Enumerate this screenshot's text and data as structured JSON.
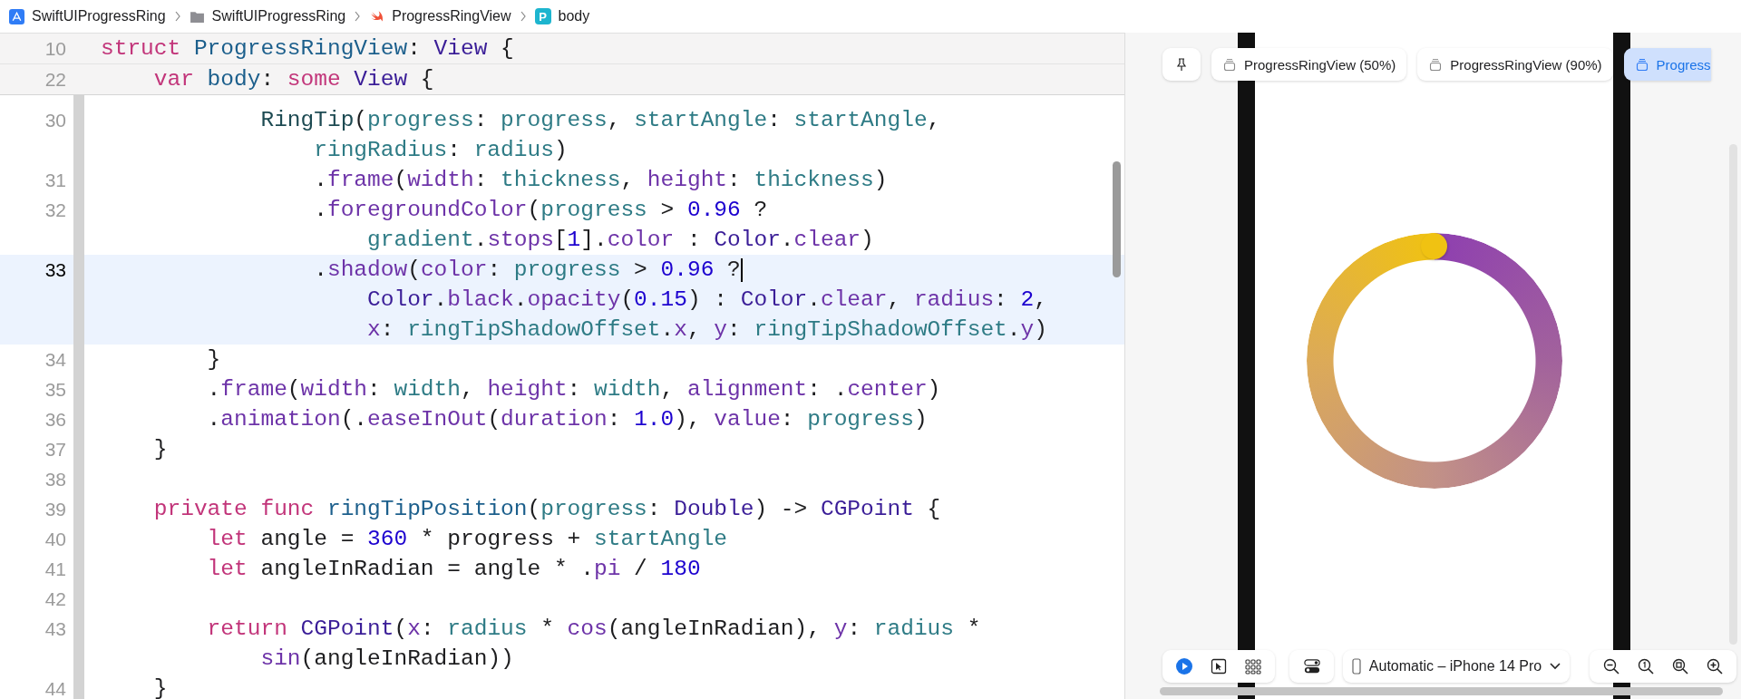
{
  "breadcrumbs": [
    {
      "kind": "app",
      "label": "SwiftUIProgressRing"
    },
    {
      "kind": "folder",
      "label": "SwiftUIProgressRing"
    },
    {
      "kind": "swift",
      "label": "ProgressRingView"
    },
    {
      "kind": "property",
      "icon_letter": "P",
      "label": "body"
    }
  ],
  "sticky_lines": [
    {
      "number": "10",
      "tokens": [
        {
          "kind": "kw",
          "text": "struct"
        },
        {
          "kind": "decl",
          "text": " ProgressRingView"
        },
        {
          "kind": "plain",
          "text": ": "
        },
        {
          "kind": "type",
          "text": "View"
        },
        {
          "kind": "plain",
          "text": " {"
        }
      ]
    },
    {
      "number": "22",
      "tokens": [
        {
          "kind": "kw",
          "text": "    var"
        },
        {
          "kind": "decl",
          "text": " body"
        },
        {
          "kind": "plain",
          "text": ": "
        },
        {
          "kind": "kw",
          "text": "some"
        },
        {
          "kind": "type",
          "text": " View"
        },
        {
          "kind": "plain",
          "text": " {"
        }
      ]
    }
  ],
  "code_lines": [
    {
      "number": "30",
      "current": false,
      "rows": [
        {
          "tokens": [
            {
              "kind": "ptype",
              "text": "            RingTip"
            },
            {
              "kind": "plain",
              "text": "("
            },
            {
              "kind": "prop",
              "text": "progress"
            },
            {
              "kind": "plain",
              "text": ": "
            },
            {
              "kind": "prop",
              "text": "progress"
            },
            {
              "kind": "plain",
              "text": ", "
            },
            {
              "kind": "prop",
              "text": "startAngle"
            },
            {
              "kind": "plain",
              "text": ": "
            },
            {
              "kind": "prop",
              "text": "startAngle"
            },
            {
              "kind": "plain",
              "text": ","
            }
          ]
        },
        {
          "tokens": [
            {
              "kind": "prop",
              "text": "                ringRadius"
            },
            {
              "kind": "plain",
              "text": ": "
            },
            {
              "kind": "prop",
              "text": "radius"
            },
            {
              "kind": "plain",
              "text": ")"
            }
          ]
        }
      ]
    },
    {
      "number": "31",
      "current": false,
      "rows": [
        {
          "tokens": [
            {
              "kind": "plain",
              "text": "                ."
            },
            {
              "kind": "fn",
              "text": "frame"
            },
            {
              "kind": "plain",
              "text": "("
            },
            {
              "kind": "fn",
              "text": "width"
            },
            {
              "kind": "plain",
              "text": ": "
            },
            {
              "kind": "prop",
              "text": "thickness"
            },
            {
              "kind": "plain",
              "text": ", "
            },
            {
              "kind": "fn",
              "text": "height"
            },
            {
              "kind": "plain",
              "text": ": "
            },
            {
              "kind": "prop",
              "text": "thickness"
            },
            {
              "kind": "plain",
              "text": ")"
            }
          ]
        }
      ]
    },
    {
      "number": "32",
      "current": false,
      "rows": [
        {
          "tokens": [
            {
              "kind": "plain",
              "text": "                ."
            },
            {
              "kind": "fn",
              "text": "foregroundColor"
            },
            {
              "kind": "plain",
              "text": "("
            },
            {
              "kind": "prop",
              "text": "progress"
            },
            {
              "kind": "plain",
              "text": " > "
            },
            {
              "kind": "num",
              "text": "0.96"
            },
            {
              "kind": "plain",
              "text": " ?"
            }
          ]
        },
        {
          "tokens": [
            {
              "kind": "prop",
              "text": "                    gradient"
            },
            {
              "kind": "plain",
              "text": "."
            },
            {
              "kind": "fn",
              "text": "stops"
            },
            {
              "kind": "plain",
              "text": "["
            },
            {
              "kind": "num",
              "text": "1"
            },
            {
              "kind": "plain",
              "text": "]."
            },
            {
              "kind": "fn",
              "text": "color"
            },
            {
              "kind": "plain",
              "text": " : "
            },
            {
              "kind": "type",
              "text": "Color"
            },
            {
              "kind": "plain",
              "text": "."
            },
            {
              "kind": "fn",
              "text": "clear"
            },
            {
              "kind": "plain",
              "text": ")"
            }
          ]
        }
      ]
    },
    {
      "number": "33",
      "current": true,
      "rows": [
        {
          "tokens": [
            {
              "kind": "plain",
              "text": "                ."
            },
            {
              "kind": "fn",
              "text": "shadow"
            },
            {
              "kind": "plain",
              "text": "("
            },
            {
              "kind": "fn",
              "text": "color"
            },
            {
              "kind": "plain",
              "text": ": "
            },
            {
              "kind": "prop",
              "text": "progress"
            },
            {
              "kind": "plain",
              "text": " > "
            },
            {
              "kind": "num",
              "text": "0.96"
            },
            {
              "kind": "plain",
              "text": " ?"
            }
          ]
        },
        {
          "tokens": [
            {
              "kind": "type",
              "text": "                    Color"
            },
            {
              "kind": "plain",
              "text": "."
            },
            {
              "kind": "fn",
              "text": "black"
            },
            {
              "kind": "plain",
              "text": "."
            },
            {
              "kind": "fn",
              "text": "opacity"
            },
            {
              "kind": "plain",
              "text": "("
            },
            {
              "kind": "num",
              "text": "0.15"
            },
            {
              "kind": "plain",
              "text": ") : "
            },
            {
              "kind": "type",
              "text": "Color"
            },
            {
              "kind": "plain",
              "text": "."
            },
            {
              "kind": "fn",
              "text": "clear"
            },
            {
              "kind": "plain",
              "text": ", "
            },
            {
              "kind": "fn",
              "text": "radius"
            },
            {
              "kind": "plain",
              "text": ": "
            },
            {
              "kind": "num",
              "text": "2"
            },
            {
              "kind": "plain",
              "text": ","
            }
          ]
        },
        {
          "tokens": [
            {
              "kind": "fn",
              "text": "                    x"
            },
            {
              "kind": "plain",
              "text": ": "
            },
            {
              "kind": "prop",
              "text": "ringTipShadowOffset"
            },
            {
              "kind": "plain",
              "text": "."
            },
            {
              "kind": "fn",
              "text": "x"
            },
            {
              "kind": "plain",
              "text": ", "
            },
            {
              "kind": "fn",
              "text": "y"
            },
            {
              "kind": "plain",
              "text": ": "
            },
            {
              "kind": "prop",
              "text": "ringTipShadowOffset"
            },
            {
              "kind": "plain",
              "text": "."
            },
            {
              "kind": "fn",
              "text": "y"
            },
            {
              "kind": "plain",
              "text": ")"
            }
          ]
        }
      ]
    },
    {
      "number": "34",
      "current": false,
      "rows": [
        {
          "tokens": [
            {
              "kind": "plain",
              "text": "        }"
            }
          ]
        }
      ]
    },
    {
      "number": "35",
      "current": false,
      "rows": [
        {
          "tokens": [
            {
              "kind": "plain",
              "text": "        ."
            },
            {
              "kind": "fn",
              "text": "frame"
            },
            {
              "kind": "plain",
              "text": "("
            },
            {
              "kind": "fn",
              "text": "width"
            },
            {
              "kind": "plain",
              "text": ": "
            },
            {
              "kind": "prop",
              "text": "width"
            },
            {
              "kind": "plain",
              "text": ", "
            },
            {
              "kind": "fn",
              "text": "height"
            },
            {
              "kind": "plain",
              "text": ": "
            },
            {
              "kind": "prop",
              "text": "width"
            },
            {
              "kind": "plain",
              "text": ", "
            },
            {
              "kind": "fn",
              "text": "alignment"
            },
            {
              "kind": "plain",
              "text": ": ."
            },
            {
              "kind": "fn",
              "text": "center"
            },
            {
              "kind": "plain",
              "text": ")"
            }
          ]
        }
      ]
    },
    {
      "number": "36",
      "current": false,
      "rows": [
        {
          "tokens": [
            {
              "kind": "plain",
              "text": "        ."
            },
            {
              "kind": "fn",
              "text": "animation"
            },
            {
              "kind": "plain",
              "text": "(."
            },
            {
              "kind": "fn",
              "text": "easeInOut"
            },
            {
              "kind": "plain",
              "text": "("
            },
            {
              "kind": "fn",
              "text": "duration"
            },
            {
              "kind": "plain",
              "text": ": "
            },
            {
              "kind": "num",
              "text": "1.0"
            },
            {
              "kind": "plain",
              "text": "), "
            },
            {
              "kind": "fn",
              "text": "value"
            },
            {
              "kind": "plain",
              "text": ": "
            },
            {
              "kind": "prop",
              "text": "progress"
            },
            {
              "kind": "plain",
              "text": ")"
            }
          ]
        }
      ]
    },
    {
      "number": "37",
      "current": false,
      "rows": [
        {
          "tokens": [
            {
              "kind": "plain",
              "text": "    }"
            }
          ]
        }
      ]
    },
    {
      "number": "38",
      "current": false
    },
    {
      "number": "39",
      "current": false,
      "rows": [
        {
          "tokens": [
            {
              "kind": "kw",
              "text": "    private"
            },
            {
              "kind": "kw",
              "text": " func"
            },
            {
              "kind": "decl",
              "text": " ringTipPosition"
            },
            {
              "kind": "plain",
              "text": "("
            },
            {
              "kind": "prop",
              "text": "progress"
            },
            {
              "kind": "plain",
              "text": ": "
            },
            {
              "kind": "type",
              "text": "Double"
            },
            {
              "kind": "plain",
              "text": ") -> "
            },
            {
              "kind": "type",
              "text": "CGPoint"
            },
            {
              "kind": "plain",
              "text": " {"
            }
          ]
        }
      ]
    },
    {
      "number": "40",
      "current": false,
      "rows": [
        {
          "tokens": [
            {
              "kind": "kw",
              "text": "        let"
            },
            {
              "kind": "plain",
              "text": " angle = "
            },
            {
              "kind": "num",
              "text": "360"
            },
            {
              "kind": "plain",
              "text": " * progress + "
            },
            {
              "kind": "prop",
              "text": "startAngle"
            }
          ]
        }
      ]
    },
    {
      "number": "41",
      "current": false,
      "rows": [
        {
          "tokens": [
            {
              "kind": "kw",
              "text": "        let"
            },
            {
              "kind": "plain",
              "text": " angleInRadian = angle * ."
            },
            {
              "kind": "fn",
              "text": "pi"
            },
            {
              "kind": "plain",
              "text": " / "
            },
            {
              "kind": "num",
              "text": "180"
            }
          ]
        }
      ]
    },
    {
      "number": "42",
      "current": false
    },
    {
      "number": "43",
      "current": false,
      "rows": [
        {
          "tokens": [
            {
              "kind": "kw",
              "text": "        return"
            },
            {
              "kind": "type",
              "text": " CGPoint"
            },
            {
              "kind": "plain",
              "text": "("
            },
            {
              "kind": "fn",
              "text": "x"
            },
            {
              "kind": "plain",
              "text": ": "
            },
            {
              "kind": "prop",
              "text": "radius"
            },
            {
              "kind": "plain",
              "text": " * "
            },
            {
              "kind": "fn",
              "text": "cos"
            },
            {
              "kind": "plain",
              "text": "(angleInRadian), "
            },
            {
              "kind": "fn",
              "text": "y"
            },
            {
              "kind": "plain",
              "text": ": "
            },
            {
              "kind": "prop",
              "text": "radius"
            },
            {
              "kind": "plain",
              "text": " *"
            }
          ]
        },
        {
          "tokens": [
            {
              "kind": "fn",
              "text": "            sin"
            },
            {
              "kind": "plain",
              "text": "(angleInRadian))"
            }
          ]
        }
      ]
    },
    {
      "number": "44",
      "current": false,
      "rows": [
        {
          "tokens": [
            {
              "kind": "plain",
              "text": "    }"
            }
          ]
        }
      ]
    }
  ],
  "preview": {
    "tabs": [
      {
        "label": "ProgressRingView (50%)",
        "selected": false
      },
      {
        "label": "ProgressRingView (90%)",
        "selected": false
      },
      {
        "label": "Progress",
        "selected": true
      }
    ],
    "device": "Automatic – iPhone 14 Pro"
  }
}
